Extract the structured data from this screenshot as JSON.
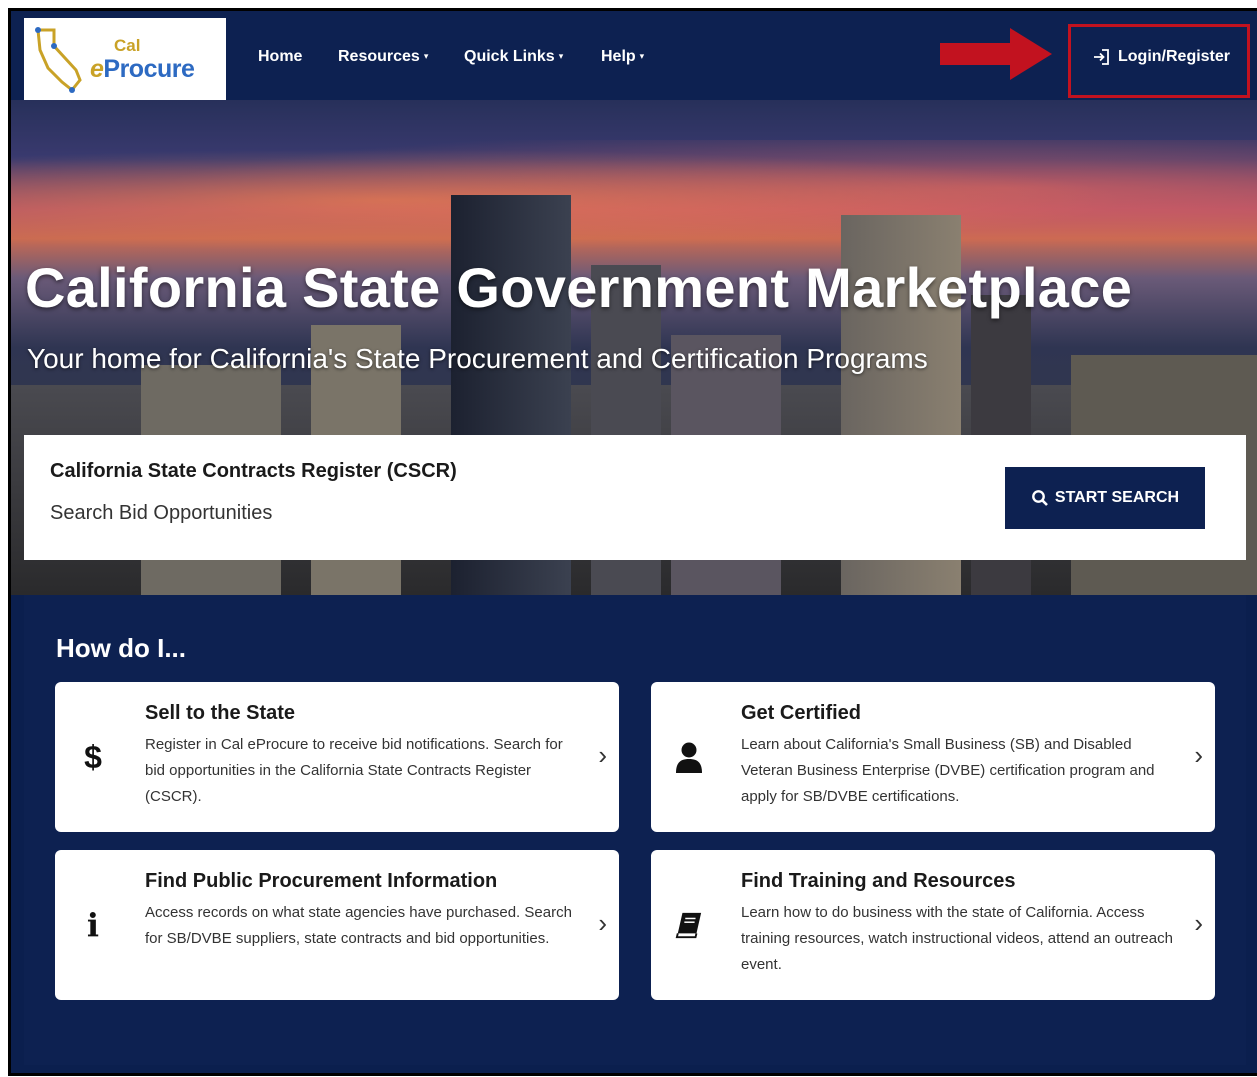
{
  "logo": {
    "line1": "Cal",
    "line2_e": "e",
    "line2_rest": "Procure"
  },
  "nav": {
    "items": [
      {
        "label": "Home"
      },
      {
        "label": "Resources"
      },
      {
        "label": "Quick Links"
      },
      {
        "label": "Help"
      }
    ],
    "caret": "▾",
    "login_label": "Login/Register"
  },
  "hero": {
    "title": "California State Government Marketplace",
    "subtitle": "Your home for California's State Procurement and Certification Programs"
  },
  "cscr": {
    "title": "California State Contracts Register (CSCR)",
    "subtitle": "Search Bid Opportunities",
    "button_label": "START SEARCH"
  },
  "howdo": {
    "title": "How do I...",
    "cards": [
      {
        "icon": "dollar-icon",
        "glyph": "$",
        "title": "Sell to the State",
        "desc": "Register in Cal eProcure to receive bid notifications. Search for bid opportunities in the California State Contracts Register (CSCR)."
      },
      {
        "icon": "user-icon",
        "glyph": "",
        "title": "Get Certified",
        "desc": "Learn about California's Small Business (SB) and Disabled Veteran Business Enterprise (DVBE) certification program and apply for SB/DVBE certifications."
      },
      {
        "icon": "info-icon",
        "glyph": "i",
        "title": "Find Public Procurement Information",
        "desc": "Access records on what state agencies have purchased. Search for SB/DVBE suppliers, state contracts and bid opportunities."
      },
      {
        "icon": "book-icon",
        "glyph": "",
        "title": "Find Training and Resources",
        "desc": "Learn how to do business with the state of California. Access training resources, watch instructional videos, attend an outreach event."
      }
    ],
    "chevron": "›"
  },
  "colors": {
    "navy": "#0d2151",
    "highlight_red": "#c2121f",
    "logo_gold": "#c9a227",
    "logo_blue": "#2d6ac2"
  }
}
